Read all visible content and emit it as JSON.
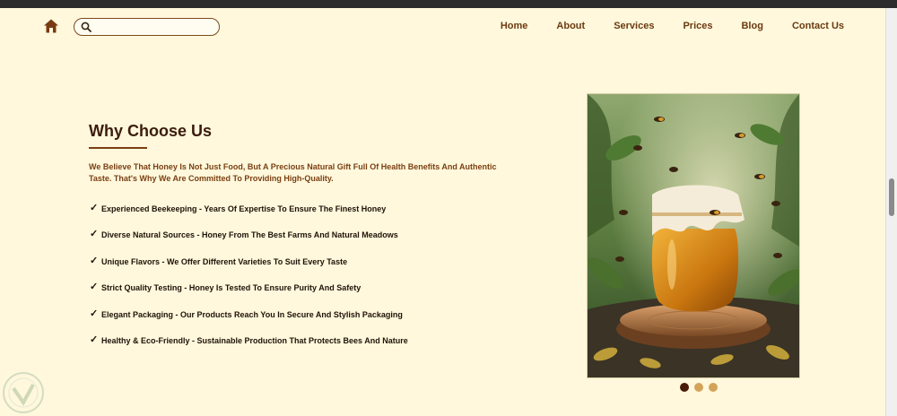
{
  "nav": {
    "search_placeholder": "",
    "links": [
      "Home",
      "About",
      "Services",
      "Prices",
      "Blog",
      "Contact Us"
    ]
  },
  "section": {
    "title": "Why Choose Us",
    "intro": "We Believe That Honey Is Not Just Food, But A Precious Natural Gift Full Of Health Benefits And Authentic Taste. That's Why We Are Committed To Providing High-Quality.",
    "features": [
      "Experienced Beekeeping - Years Of Expertise To Ensure The Finest Honey",
      "Diverse Natural Sources - Honey From The Best Farms And Natural Meadows",
      "Unique Flavors - We Offer Different Varieties To Suit Every Taste",
      "Strict Quality Testing - Honey Is Tested To Ensure Purity And Safety",
      "Elegant Packaging - Our Products Reach You In Secure And Stylish Packaging",
      "Healthy & Eco-Friendly - Sustainable Production That Protects Bees And Nature"
    ],
    "check_glyph": "✓"
  },
  "carousel": {
    "slide_count": 3,
    "active_index": 0
  },
  "colors": {
    "background": "#fff8dc",
    "accent": "#7a3f12",
    "nav_text": "#6b3a10",
    "dot_active": "#4a1a08",
    "dot_inactive": "#d4a35a"
  },
  "icons": [
    "home-icon",
    "search-icon",
    "check-icon",
    "honey-jar-image",
    "watermark-logo"
  ]
}
